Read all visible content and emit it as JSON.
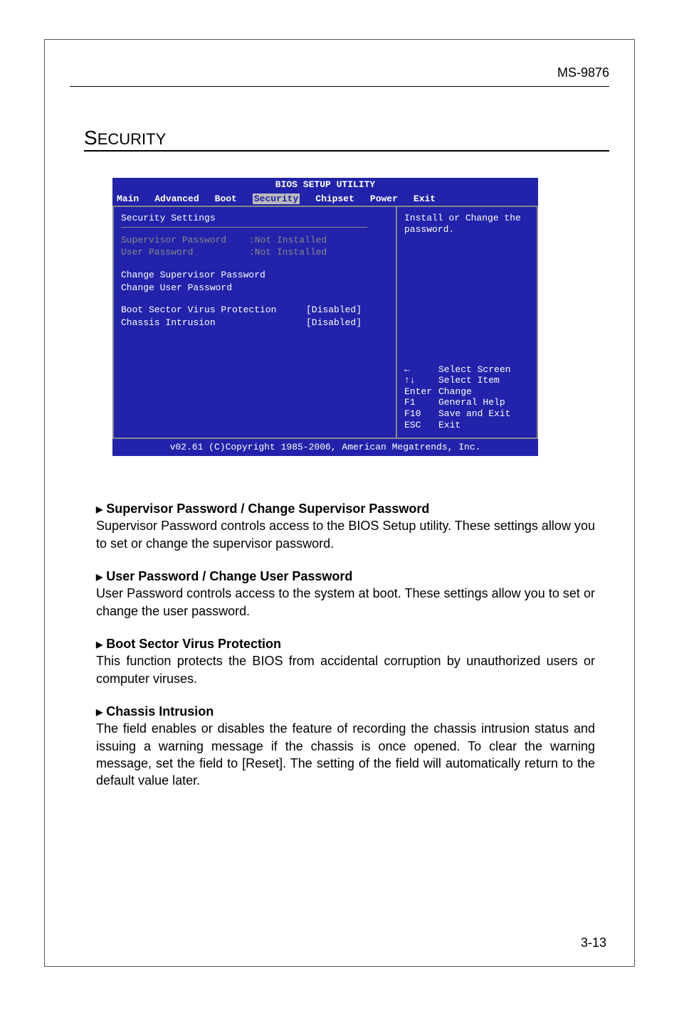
{
  "doc_id": "MS-9876",
  "page_section_title_pre": "S",
  "page_section_title_rest": "ECURITY",
  "bios": {
    "title": "BIOS SETUP UTILITY",
    "menu": [
      "Main",
      "Advanced",
      "Boot",
      "Security",
      "Chipset",
      "Power",
      "Exit"
    ],
    "left_title": "Security Settings",
    "rows": {
      "supervisor_label": "Supervisor Password",
      "supervisor_value": ":Not Installed",
      "user_label": "User Password",
      "user_value": ":Not Installed"
    },
    "actions": {
      "change_sup": "Change Supervisor Password",
      "change_user": "Change User Password"
    },
    "items": {
      "bsvp_label": "Boot Sector Virus Protection",
      "bsvp_value": "[Disabled]",
      "ci_label": "Chassis Intrusion",
      "ci_value": "[Disabled]"
    },
    "help_text": "Install or Change the password.",
    "legend": {
      "l1k": "←",
      "l1t": "Select Screen",
      "l2k": "↑↓",
      "l2t": "Select Item",
      "l3k": "Enter",
      "l3t": "Change",
      "l4k": "F1",
      "l4t": "General Help",
      "l5k": "F10",
      "l5t": "Save and Exit",
      "l6k": "ESC",
      "l6t": "Exit"
    },
    "footer": "v02.61 (C)Copyright 1985-2006, American Megatrends, Inc."
  },
  "body": {
    "h1": "Supervisor Password / Change Supervisor Password",
    "p1": "Supervisor Password controls access to the BIOS Setup utility. These settings allow you to set or change the supervisor password.",
    "h2": "User Password / Change User Password",
    "p2": "User Password controls access to the system at boot. These settings allow you to set or change the user password.",
    "h3": "Boot Sector Virus Protection",
    "p3": "This function protects the BIOS from accidental corruption by unauthorized users or computer viruses.",
    "h4": "Chassis Intrusion",
    "p4": "The field enables or disables the feature of recording the chassis intrusion status and issuing a warning message if the chassis is once opened. To clear the warning message, set the field to [Reset]. The setting of the field will automatically return to the default value later."
  },
  "page_number": "3-13"
}
